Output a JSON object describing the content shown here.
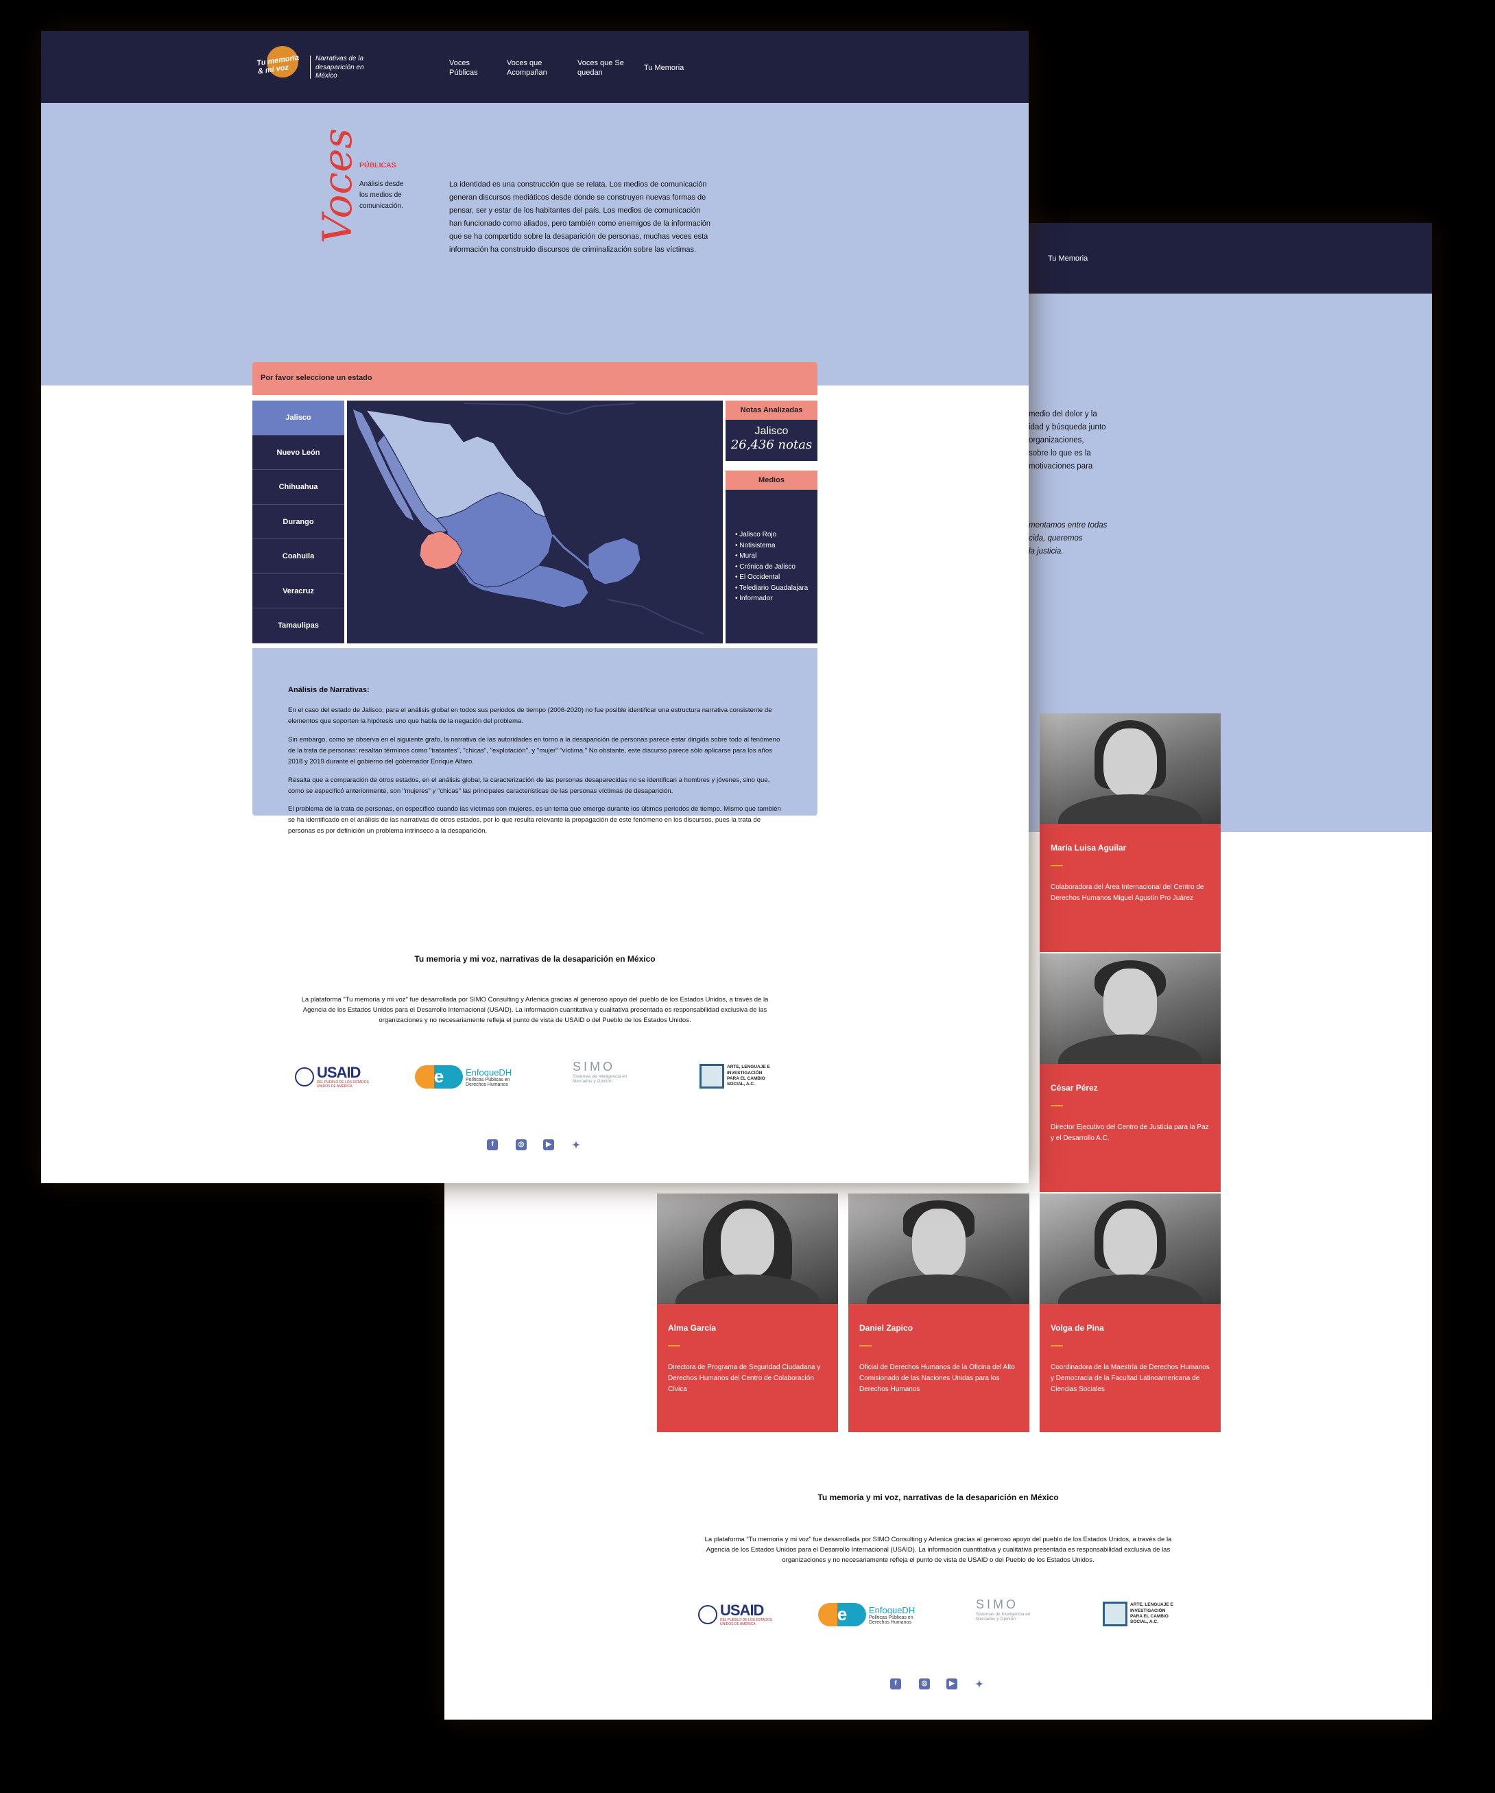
{
  "nav": {
    "logo_text": "Tu memoria & mi voz",
    "tagline": "Narrativas de la desaparición en México",
    "links": [
      "Voces Públicas",
      "Voces que Acompañan",
      "Voces que Se quedan",
      "Tu Memoria"
    ]
  },
  "back_page": {
    "nav_link": "Tu Memoria",
    "intro_lines": [
      "medio del dolor y la",
      "idad y búsqueda junto",
      "organizaciones,",
      "sobre lo que es la",
      "motivaciones para"
    ],
    "italic_lines": [
      "mentamos entre todas",
      "cida, queremos",
      "la justicia."
    ],
    "cards": [
      {
        "name": "María Luisa Aguilar",
        "role": "Colaboradora del Área Internacional del Centro de Derechos Humanos Miguel Agustín Pro Juárez"
      },
      {
        "name": "César Pérez",
        "role": "Director Ejecutivo del Centro de Justicia para la Paz y el Desarrollo A.C."
      },
      {
        "name": "Alma García",
        "role": "Directora de Programa de Seguridad Ciudadana y Derechos Humanos del Centro de Colaboración Cívica"
      },
      {
        "name": "Daniel Zapico",
        "role": "Oficial de Derechos Humanos de la Oficina del Alto Comisionado de las Naciones Unidas para los Derechos Humanos"
      },
      {
        "name": "Volga de Pina",
        "role": "Coordinadora de la Maestría de Derechos Humanos y Democracia de la Facultad Latinoamericana de Ciencias Sociales"
      }
    ]
  },
  "front_page": {
    "section_word": "Voces",
    "section_tag": "PÚBLICAS",
    "section_sub": "Análisis desde los medios de comunicación.",
    "intro": "La identidad es una construcción que se relata. Los medios de comunicación generan discursos mediáticos desde donde se construyen nuevas formas de pensar, ser y estar de los habitantes del país. Los medios de comunicación han funcionado como aliados, pero también como enemigos de la información que se ha compartido sobre la desaparición de personas, muchas veces esta información ha construido discursos de criminalización sobre las víctimas.",
    "select_label": "Por favor seleccione un estado",
    "states": [
      "Jalisco",
      "Nuevo León",
      "Chihuahua",
      "Durango",
      "Coahuila",
      "Veracruz",
      "Tamaulipas"
    ],
    "active_state": "Jalisco",
    "notas_header": "Notas Analizadas",
    "notas_state": "Jalisco",
    "notas_count": "26,436 notas",
    "medios_header": "Medios",
    "medios": [
      "Jalisco Rojo",
      "Notisistema",
      "Mural",
      "Crónica de Jalisco",
      "El Occidental",
      "Telediario Guadalajara",
      "Informador"
    ],
    "analysis_title": "Análisis de Narrativas:",
    "analysis_paragraphs": [
      "En el caso del estado de Jalisco, para el análisis global en todos sus periodos de tiempo (2006-2020) no fue posible identificar una estructura narrativa consistente de elementos que soporten la hipótesis uno que habla de la negación del problema.",
      "Sin embargo, como se observa en el siguiente grafo, la narrativa de las autoridades en torno a la desaparición de personas parece estar dirigida sobre todo al fenómeno de la trata de personas: resaltan términos como \"tratantes\", \"chicas\", \"explotación\", y \"mujer\" \"víctima.\" No obstante, este discurso parece sólo aplicarse para los años 2018 y 2019 durante el gobierno del gobernador Enrique Alfaro.",
      "Resalta que a comparación de otros estados, en el análisis global, la caracterización de las personas desaparecidas no se identifican a hombres y jóvenes, sino que, como se especificó anteriormente, son \"mujeres\" y \"chicas\" las principales características de las personas víctimas de desaparición.",
      "El problema de la trata de personas, en específico cuando las víctimas son mujeres, es un tema que emerge durante los últimos periodos de tiempo. Mismo que también se ha identificado en el análisis de las narrativas de otros estados, por lo que resulta relevante la propagación de este fenómeno en los discursos, pues la trata de personas es por definición un problema intrínseco a la desaparición."
    ]
  },
  "footer": {
    "title": "Tu memoria y mi voz, narrativas de la desaparición en México",
    "text_lines": [
      "La plataforma \"Tu memoria y mi voz\" fue desarrollada por SIMO Consulting y Arlenica gracias al generoso apoyo del pueblo de los Estados Unidos, a través de la",
      "Agencia de los Estados Unidos para el Desarrollo Internacional (USAID). La información cuantitativa y cualitativa presentada es responsabilidad exclusiva de las",
      "organizaciones y no necesariamente refleja el punto de vista de USAID o del Pueblo de los Estados Unidos."
    ],
    "logos": {
      "usaid": "USAID",
      "usaid_sub": "DEL PUEBLO DE LOS ESTADOS UNIDOS DE AMÉRICA",
      "enfoque": "EnfoqueDH",
      "enfoque_sub": "Políticas Públicas en Derechos Humanos",
      "simo": "SIMO",
      "simo_sub": "Sistemas de Inteligencia en Mercados y Opinión",
      "arlenica": "ARTE, LENGUAJE E INVESTIGACIÓN PARA EL CAMBIO SOCIAL, A.C."
    },
    "social_icons": [
      "facebook-icon",
      "instagram-icon",
      "youtube-icon",
      "twitter-icon"
    ]
  },
  "colors": {
    "nav": "#20203f",
    "band": "#b3c2e3",
    "accent_red": "#dd4444",
    "salmon": "#f08d83",
    "active_state": "#6b7ec3",
    "map_highlight": "#f08d83"
  }
}
